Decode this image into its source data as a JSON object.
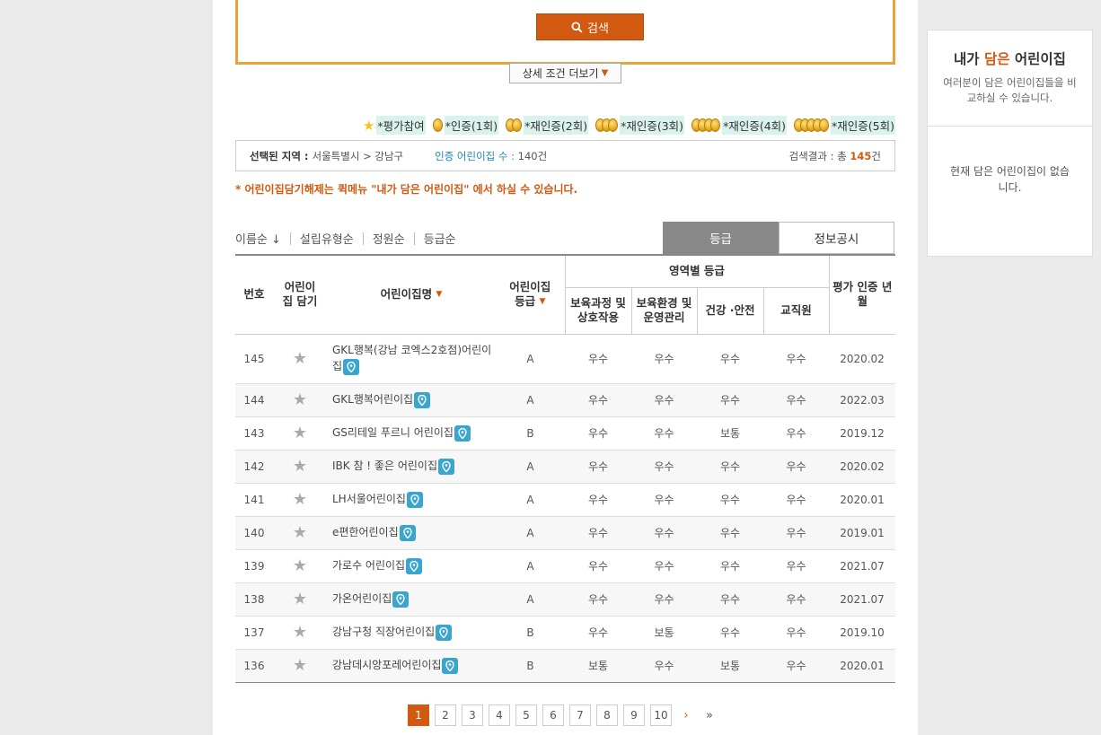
{
  "search": {
    "button_label": "검색",
    "more_label": "상세 조건 더보기"
  },
  "legend": [
    {
      "label": "*평가참여",
      "medals": 0
    },
    {
      "label": "*인증(1회)",
      "medals": 1
    },
    {
      "label": "*재인증(2회)",
      "medals": 2
    },
    {
      "label": "*재인증(3회)",
      "medals": 3
    },
    {
      "label": "*재인증(4회)",
      "medals": 4
    },
    {
      "label": "*재인증(5회)",
      "medals": 5
    }
  ],
  "region": {
    "label": "선택된 지역 :",
    "value": "서울특별시 > 강남구",
    "cert_label": "인증 어린이집 수 :",
    "cert_count": "140건",
    "result_prefix": "검색결과 : 총",
    "result_count": "145",
    "result_suffix": "건"
  },
  "notice": "* 어린이집담기해제는 퀵메뉴 \"내가 담은 어린이집\" 에서 하실 수 있습니다.",
  "sort": [
    "이름순 ↓",
    "설립유형순",
    "정원순",
    "등급순"
  ],
  "tabs": [
    {
      "label": "등급",
      "active": true
    },
    {
      "label": "정보공시",
      "active": false
    }
  ],
  "table": {
    "headers": {
      "no": "번호",
      "save": "어린이집 담기",
      "name": "어린이집명",
      "grade": "어린이집 등급",
      "area": "영역별 등급",
      "sub": [
        "보육과정 및 상호작용",
        "보육환경 및 운영관리",
        "건강 ·안전",
        "교직원"
      ],
      "year": "평가 인증 년월"
    },
    "rows": [
      {
        "no": "145",
        "name": "GKL행복(강남 코엑스2호점)어린이집",
        "grade": "A",
        "g1": "우수",
        "g2": "우수",
        "g3": "우수",
        "g4": "우수",
        "date": "2020.02"
      },
      {
        "no": "144",
        "name": "GKL행복어린이집",
        "grade": "A",
        "g1": "우수",
        "g2": "우수",
        "g3": "우수",
        "g4": "우수",
        "date": "2022.03"
      },
      {
        "no": "143",
        "name": "GS리테일 푸르니 어린이집",
        "grade": "B",
        "g1": "우수",
        "g2": "우수",
        "g3": "보통",
        "g4": "우수",
        "date": "2019.12"
      },
      {
        "no": "142",
        "name": "IBK 참 ! 좋은 어린이집",
        "grade": "A",
        "g1": "우수",
        "g2": "우수",
        "g3": "우수",
        "g4": "우수",
        "date": "2020.02"
      },
      {
        "no": "141",
        "name": "LH서울어린이집",
        "grade": "A",
        "g1": "우수",
        "g2": "우수",
        "g3": "우수",
        "g4": "우수",
        "date": "2020.01"
      },
      {
        "no": "140",
        "name": "e편한어린이집",
        "grade": "A",
        "g1": "우수",
        "g2": "우수",
        "g3": "우수",
        "g4": "우수",
        "date": "2019.01"
      },
      {
        "no": "139",
        "name": "가로수 어린이집",
        "grade": "A",
        "g1": "우수",
        "g2": "우수",
        "g3": "우수",
        "g4": "우수",
        "date": "2021.07"
      },
      {
        "no": "138",
        "name": "가온어린이집",
        "grade": "A",
        "g1": "우수",
        "g2": "우수",
        "g3": "우수",
        "g4": "우수",
        "date": "2021.07"
      },
      {
        "no": "137",
        "name": "강남구청 직장어린이집",
        "grade": "B",
        "g1": "우수",
        "g2": "보통",
        "g3": "우수",
        "g4": "우수",
        "date": "2019.10"
      },
      {
        "no": "136",
        "name": "강남데시앙포레어린이집",
        "grade": "B",
        "g1": "보통",
        "g2": "우수",
        "g3": "보통",
        "g4": "우수",
        "date": "2020.01"
      }
    ]
  },
  "pager": {
    "pages": [
      "1",
      "2",
      "3",
      "4",
      "5",
      "6",
      "7",
      "8",
      "9",
      "10"
    ],
    "active": "1",
    "next": "›",
    "last": "»"
  },
  "side": {
    "title_pre": "내가 ",
    "title_hl": "담은",
    "title_post": " 어린이집",
    "desc": "여러분이 담은 어린이집들을 비교하실 수 있습니다.",
    "empty": "현재 담은 어린이집이 없습니다."
  },
  "colors": {
    "accent": "#d25a10",
    "border": "#e8a33a",
    "pin": "#3aa6cf",
    "legend_bg": "#d9f2ec"
  }
}
